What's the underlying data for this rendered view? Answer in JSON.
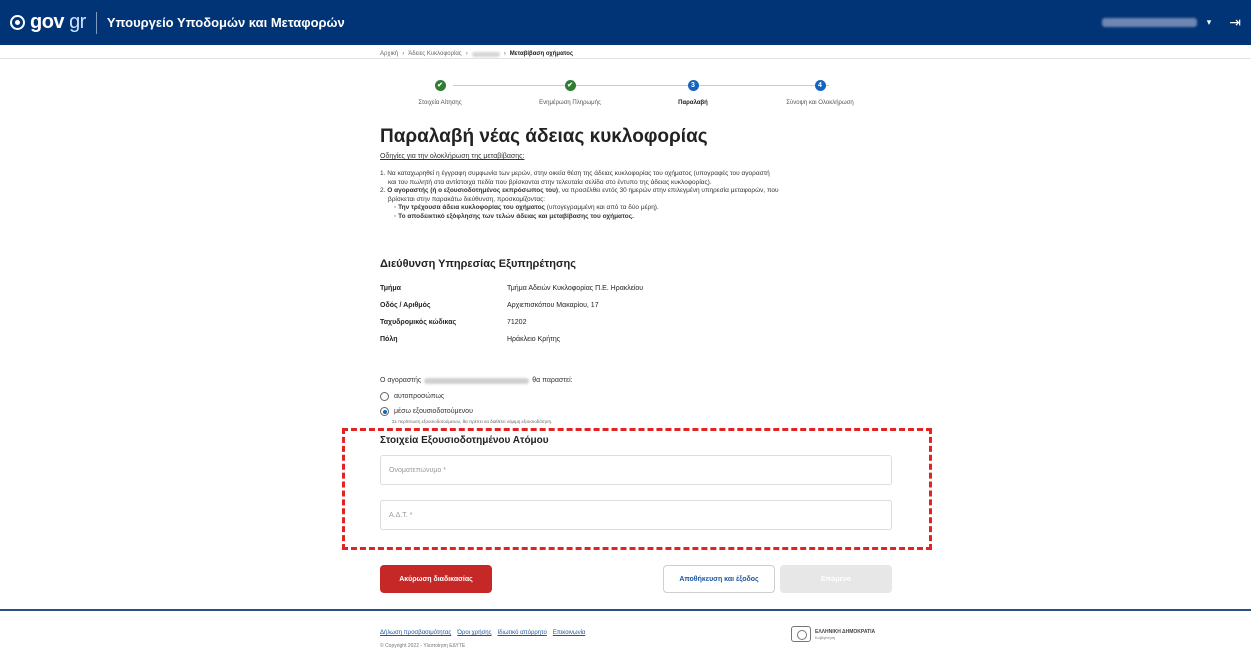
{
  "header": {
    "logo_text": "gov",
    "logo_gr": "gr",
    "ministry": "Υπουργείο Υποδομών και Μεταφορών",
    "caret": "▾",
    "logout_icon": "⇥"
  },
  "breadcrumb": {
    "items": [
      "Αρχική",
      "Άδειες Κυκλοφορίας"
    ],
    "separator": "›",
    "current": "Μεταβίβαση οχήματος"
  },
  "stepper": {
    "steps": [
      {
        "label": "Στοιχεία Αίτησης",
        "marker": "✔"
      },
      {
        "label": "Ενημέρωση Πληρωμής",
        "marker": "✔"
      },
      {
        "label": "Παραλαβή",
        "marker": "3"
      },
      {
        "label": "Σύνοψη και Ολοκλήρωση",
        "marker": "4"
      }
    ]
  },
  "page": {
    "title": "Παραλαβή νέας άδειας κυκλοφορίας",
    "instructions_title": "Οδηγίες για την ολοκλήρωση της μεταβίβασης:",
    "instr1": "1. Να καταχωρηθεί η έγγραφη συμφωνία των μερών, στην οικεία θέση της άδειας κυκλοφορίας του οχήματος (υπογραφές του αγοραστή",
    "instr1b": "και του πωλητή στα αντίστοιχα πεδία που βρίσκονται στην τελευταία σελίδα στο έντυπο της άδειας κυκλοφορίας).",
    "instr2_pre": "2. ",
    "instr2_bold": "Ο αγοραστής (ή ο εξουσιοδοτημένος εκπρόσωπος του)",
    "instr2_rest": ", να προσέλθει εντός 30 ημερών στην επιλεγμένη υπηρεσία μεταφορών, που",
    "instr2b": "βρίσκεται στην παρακάτω διεύθυνση, προσκομίζοντας:",
    "bullet1_bold": "Την τρέχουσα άδεια κυκλοφορίας του οχήματος",
    "bullet1_rest": " (υπογεγραμμένη και από τα δύο μέρη).",
    "bullet2_bold": "Το αποδεικτικό εξόφλησης των τελών άδειας και μεταβίβασης του οχήματος.",
    "bullet_symbol": "◦"
  },
  "address": {
    "title": "Διεύθυνση Υπηρεσίας Εξυπηρέτησης",
    "rows": [
      {
        "key": "Τμήμα",
        "value": "Τμήμα Αδειών Κυκλοφορίας Π.Ε. Ηρακλείου"
      },
      {
        "key": "Οδός / Αριθμός",
        "value": "Αρχιεπισκόπου Μακαρίου, 17"
      },
      {
        "key": "Ταχυδρομικός κώδικας",
        "value": "71202"
      },
      {
        "key": "Πόλη",
        "value": "Ηράκλειο Κρήτης"
      }
    ]
  },
  "attendance": {
    "prefix": "Ο αγοραστής",
    "suffix": "θα παραστεί:",
    "option_in_person": "αυτοπροσώπως",
    "option_authorized": "μέσω εξουσιοδοτούμενου",
    "selected": "μέσω εξουσιοδοτούμενου",
    "note": "Σε περίπτωση εξουσιοδοτούμενου, θα πρέπει να διαθέτει νόμιμη εξουσιοδότηση."
  },
  "authorized": {
    "title": "Στοιχεία Εξουσιοδοτημένου Ατόμου",
    "name_placeholder": "Ονοματεπώνυμο *",
    "id_placeholder": "Α.Δ.Τ. *",
    "highlight_color": "#e32222"
  },
  "actions": {
    "cancel": "Ακύρωση διαδικασίας",
    "save_exit": "Αποθήκευση και έξοδος",
    "next": "Επόμενο"
  },
  "footer": {
    "links": [
      "Δήλωση προσβασιμότητας",
      "Όροι χρήσης",
      "Ιδιωτικό απόρρητο",
      "Επικοινωνία"
    ],
    "copyright": "© Copyright 2022 - Υλοποίηση ΕΔΥΤΕ",
    "republic": "ΕΛΛΗΝΙΚΗ ΔΗΜΟΚΡΑΤΙΑ",
    "government": "Κυβέρνηση"
  },
  "colors": {
    "brand": "#003476",
    "step_done": "#2e7d32",
    "step_active": "#1565c0",
    "cancel": "#c62828"
  }
}
